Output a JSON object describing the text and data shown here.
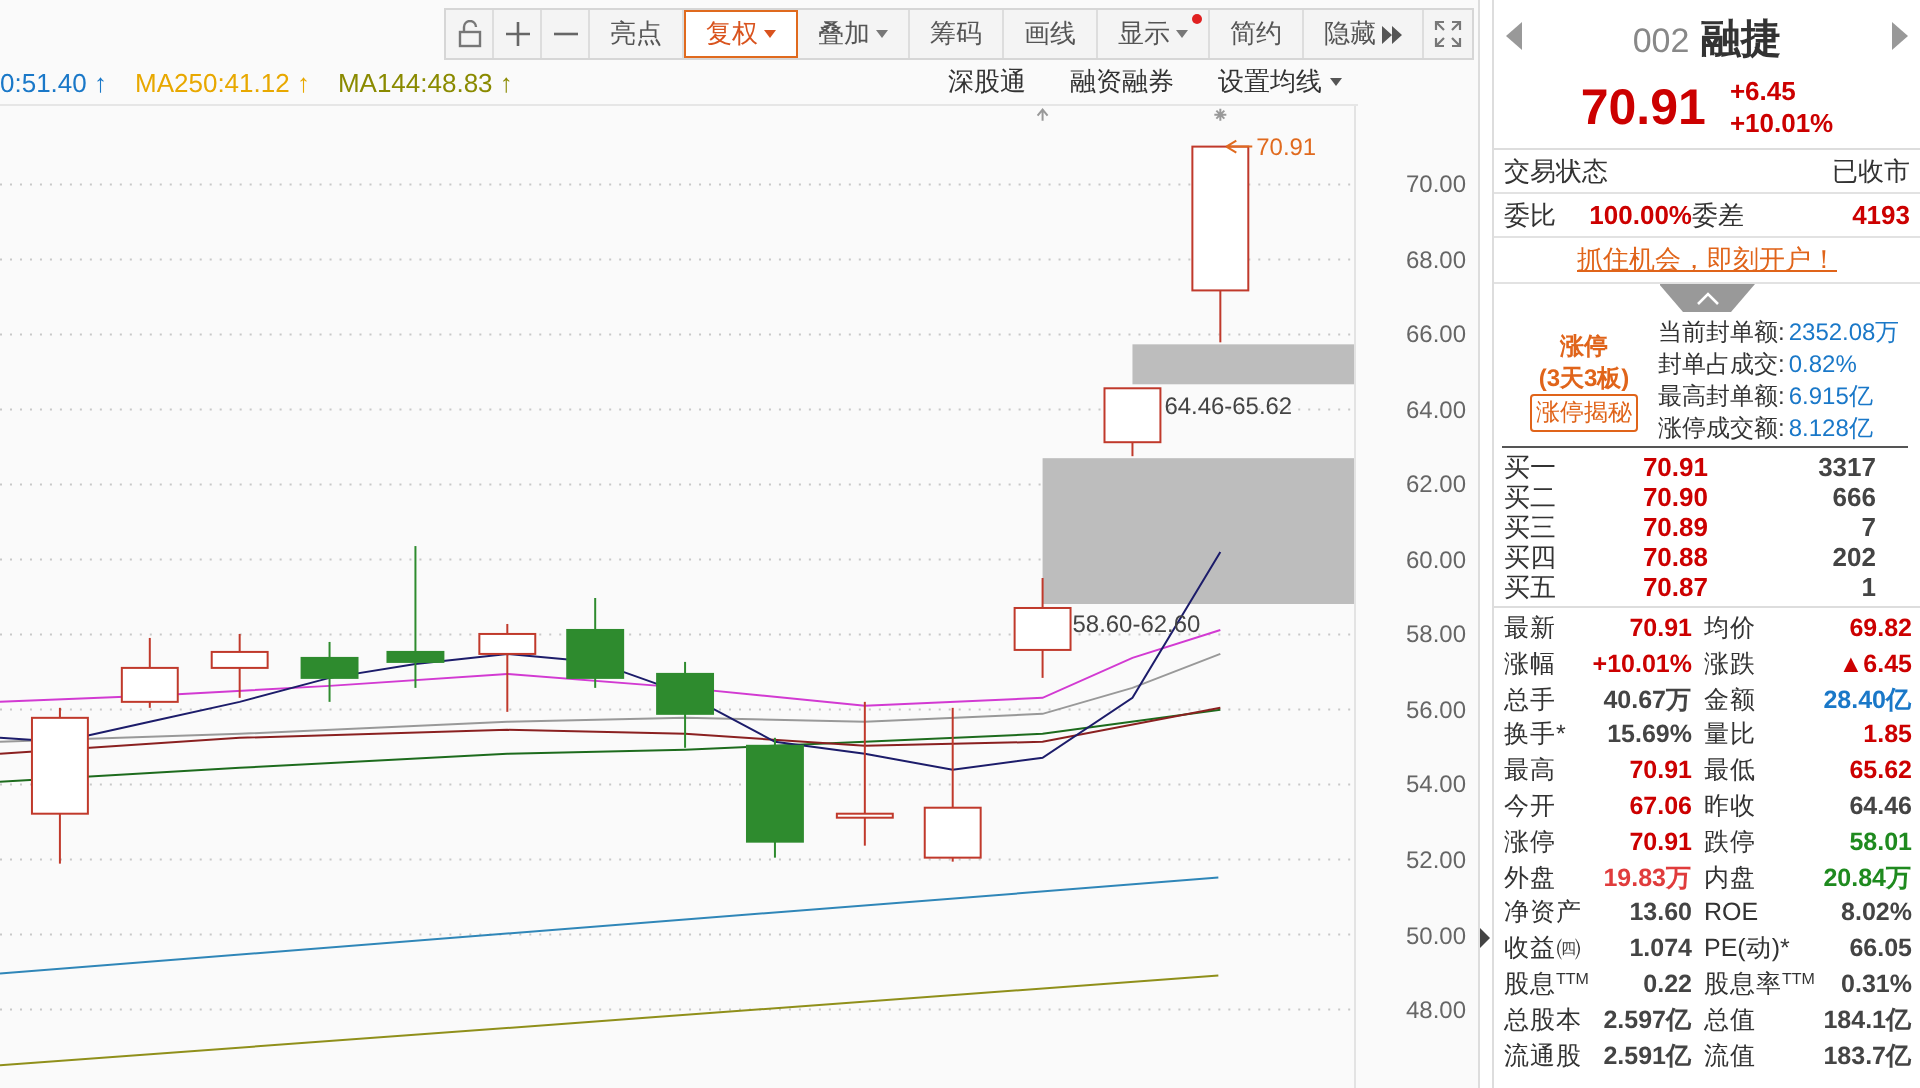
{
  "toolbar": {
    "buttons": [
      {
        "label": "亮点",
        "selected": false,
        "menu": false,
        "notice": false,
        "more": false
      },
      {
        "label": "复权",
        "selected": true,
        "menu": true,
        "notice": false,
        "more": false
      },
      {
        "label": "叠加",
        "selected": false,
        "menu": true,
        "notice": false,
        "more": false
      },
      {
        "label": "筹码",
        "selected": false,
        "menu": false,
        "notice": false,
        "more": false
      },
      {
        "label": "画线",
        "selected": false,
        "menu": false,
        "notice": false,
        "more": false
      },
      {
        "label": "显示",
        "selected": false,
        "menu": true,
        "notice": true,
        "more": false
      },
      {
        "label": "简约",
        "selected": false,
        "menu": false,
        "notice": false,
        "more": false
      },
      {
        "label": "隐藏",
        "selected": false,
        "menu": false,
        "notice": false,
        "more": true
      }
    ]
  },
  "legend": [
    {
      "text": "0:51.40 ↑",
      "color": "#1a78c8"
    },
    {
      "text": "MA250:41.12 ↑",
      "color": "#e8a800"
    },
    {
      "text": "MA144:48.83 ↑",
      "color": "#8a8a00"
    }
  ],
  "chart_links": [
    {
      "label": "深股通",
      "menu": false
    },
    {
      "label": "融资融券",
      "menu": false
    },
    {
      "label": "设置均线",
      "menu": true
    }
  ],
  "chart": {
    "y_ticks": [
      "70.00",
      "68.00",
      "66.00",
      "64.00",
      "62.00",
      "60.00",
      "58.00",
      "56.00",
      "54.00",
      "52.00",
      "50.00",
      "48.00"
    ],
    "annotations": [
      {
        "kind": "price-arrow",
        "text": "70.91"
      },
      {
        "kind": "range",
        "text": "64.46-65.62"
      },
      {
        "kind": "range",
        "text": "58.60-62.60"
      }
    ]
  },
  "quote": {
    "code": "002",
    "name": "融捷",
    "price": "70.91",
    "change": "+6.45",
    "change_pct": "+10.01%",
    "status_label": "交易状态",
    "status": "已收市",
    "ratio": [
      {
        "label": "委比",
        "value": "100.00%"
      },
      {
        "label": "委差",
        "value": "4193"
      }
    ],
    "promo": "抓住机会，即刻开户！",
    "limit": {
      "title": "涨停",
      "streak": "(3天3板)",
      "button": "涨停揭秘",
      "stats": [
        {
          "label": "当前封单额:",
          "value": "2352.08万"
        },
        {
          "label": "封单占成交:",
          "value": "0.82%"
        },
        {
          "label": "最高封单额:",
          "value": "6.915亿"
        },
        {
          "label": "涨停成交额:",
          "value": "8.128亿"
        }
      ]
    },
    "bids": [
      {
        "label": "买一",
        "price": "70.91",
        "volume": "3317"
      },
      {
        "label": "买二",
        "price": "70.90",
        "volume": "666"
      },
      {
        "label": "买三",
        "price": "70.89",
        "volume": "7"
      },
      {
        "label": "买四",
        "price": "70.88",
        "volume": "202"
      },
      {
        "label": "买五",
        "price": "70.87",
        "volume": "1"
      }
    ],
    "stats": [
      {
        "label": "最新",
        "value": "70.91",
        "kind": "up"
      },
      {
        "label": "均价",
        "value": "69.82",
        "kind": "up"
      },
      {
        "label": "涨幅",
        "value": "+10.01%",
        "kind": "up"
      },
      {
        "label": "涨跌",
        "value": "▲6.45",
        "kind": "up"
      },
      {
        "label": "总手",
        "value": "40.67万",
        "kind": "neutral"
      },
      {
        "label": "金额",
        "value": "28.40亿",
        "kind": "amount"
      },
      {
        "label": "换手*",
        "value": "15.69%",
        "kind": "neutral"
      },
      {
        "label": "量比",
        "value": "1.85",
        "kind": "up"
      },
      {
        "label": "最高",
        "value": "70.91",
        "kind": "up"
      },
      {
        "label": "最低",
        "value": "65.62",
        "kind": "up"
      },
      {
        "label": "今开",
        "value": "67.06",
        "kind": "up"
      },
      {
        "label": "昨收",
        "value": "64.46",
        "kind": "neutral"
      },
      {
        "label": "涨停",
        "value": "70.91",
        "kind": "up"
      },
      {
        "label": "跌停",
        "value": "58.01",
        "kind": "down"
      },
      {
        "label": "外盘",
        "value": "19.83万",
        "kind": "outer"
      },
      {
        "label": "内盘",
        "value": "20.84万",
        "kind": "down"
      },
      {
        "label": "净资产",
        "value": "13.60",
        "kind": "neutral"
      },
      {
        "label": "ROE",
        "value": "8.02%",
        "kind": "neutral"
      },
      {
        "label": "收益㈣",
        "value": "1.074",
        "kind": "neutral"
      },
      {
        "label": "PE(动)*",
        "value": "66.05",
        "kind": "neutral"
      },
      {
        "label": "股息$^{TTM}$",
        "value": "0.22",
        "kind": "neutral"
      },
      {
        "label": "股息率$^{TTM}$",
        "value": "0.31%",
        "kind": "neutral"
      },
      {
        "label": "总股本",
        "value": "2.597亿",
        "kind": "neutral"
      },
      {
        "label": "总值",
        "value": "184.1亿",
        "kind": "neutral"
      },
      {
        "label": "流通股",
        "value": "2.591亿",
        "kind": "neutral"
      },
      {
        "label": "流值",
        "value": "183.7亿",
        "kind": "neutral"
      }
    ]
  }
}
